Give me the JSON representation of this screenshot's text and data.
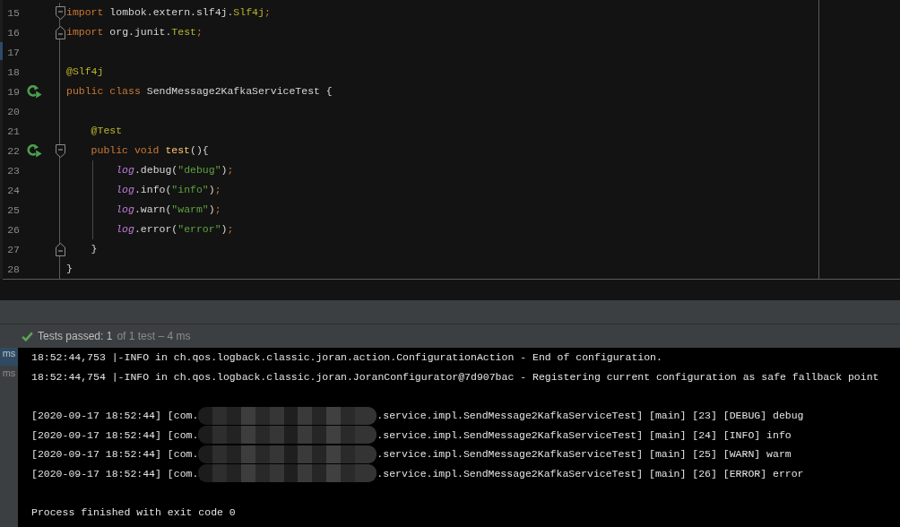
{
  "editor": {
    "lines": [
      {
        "number": "15",
        "run_icon": false,
        "fold_start": true,
        "fold_end": false,
        "tokens": [
          {
            "text": "import",
            "kind": "keyword"
          },
          {
            "text": " lombok.extern.slf4j.",
            "kind": "plain"
          },
          {
            "text": "Slf4j",
            "kind": "type"
          },
          {
            "text": ";",
            "kind": "punct"
          }
        ]
      },
      {
        "number": "16",
        "run_icon": false,
        "fold_start": false,
        "fold_end": true,
        "tokens": [
          {
            "text": "import",
            "kind": "keyword"
          },
          {
            "text": " org.junit.",
            "kind": "plain"
          },
          {
            "text": "Test",
            "kind": "type"
          },
          {
            "text": ";",
            "kind": "punct"
          }
        ]
      },
      {
        "number": "17",
        "run_icon": false,
        "fold_start": false,
        "fold_end": false
      },
      {
        "number": "18",
        "run_icon": false,
        "fold_start": false,
        "fold_end": false,
        "tokens": [
          {
            "text": "@Slf4j",
            "kind": "annotation"
          }
        ]
      },
      {
        "number": "19",
        "run_icon": true,
        "fold_start": false,
        "fold_end": false,
        "tokens": [
          {
            "text": "public class",
            "kind": "keyword"
          },
          {
            "text": " SendMessage2KafkaServiceTest {",
            "kind": "plain"
          }
        ],
        "children": [
          {
            "number": "20",
            "run_icon": false,
            "fold_start": false,
            "fold_end": false
          },
          {
            "number": "21",
            "run_icon": false,
            "fold_start": false,
            "fold_end": false,
            "tokens": [
              {
                "text": "@Test",
                "kind": "annotation"
              }
            ]
          },
          {
            "number": "22",
            "run_icon": true,
            "fold_start": true,
            "fold_end": false,
            "tokens": [
              {
                "text": "public void",
                "kind": "keyword"
              },
              {
                "text": " test",
                "kind": "method"
              },
              {
                "text": "(){",
                "kind": "plain"
              }
            ],
            "children": [
              {
                "number": "23",
                "run_icon": false,
                "fold_start": false,
                "fold_end": false,
                "tokens": [
                  {
                    "text": "log",
                    "kind": "field"
                  },
                  {
                    "text": ".debug(",
                    "kind": "plain"
                  },
                  {
                    "text": "\"debug\"",
                    "kind": "string"
                  },
                  {
                    "text": ")",
                    "kind": "plain"
                  },
                  {
                    "text": ";",
                    "kind": "punct"
                  }
                ]
              },
              {
                "number": "24",
                "run_icon": false,
                "fold_start": false,
                "fold_end": false,
                "tokens": [
                  {
                    "text": "log",
                    "kind": "field"
                  },
                  {
                    "text": ".info(",
                    "kind": "plain"
                  },
                  {
                    "text": "\"info\"",
                    "kind": "string"
                  },
                  {
                    "text": ")",
                    "kind": "plain"
                  },
                  {
                    "text": ";",
                    "kind": "punct"
                  }
                ]
              },
              {
                "number": "25",
                "run_icon": false,
                "fold_start": false,
                "fold_end": false,
                "tokens": [
                  {
                    "text": "log",
                    "kind": "field"
                  },
                  {
                    "text": ".warn(",
                    "kind": "plain"
                  },
                  {
                    "text": "\"warm\"",
                    "kind": "string"
                  },
                  {
                    "text": ")",
                    "kind": "plain"
                  },
                  {
                    "text": ";",
                    "kind": "punct"
                  }
                ]
              },
              {
                "number": "26",
                "run_icon": false,
                "fold_start": false,
                "fold_end": false,
                "tokens": [
                  {
                    "text": "log",
                    "kind": "field"
                  },
                  {
                    "text": ".error(",
                    "kind": "plain"
                  },
                  {
                    "text": "\"error\"",
                    "kind": "string"
                  },
                  {
                    "text": ")",
                    "kind": "plain"
                  },
                  {
                    "text": ";",
                    "kind": "punct"
                  }
                ]
              }
            ]
          },
          {
            "number": "27",
            "run_icon": false,
            "fold_start": false,
            "fold_end": true,
            "tokens": [
              {
                "text": "}",
                "kind": "plain"
              }
            ]
          }
        ]
      },
      {
        "number": "28",
        "run_icon": false,
        "fold_start": false,
        "fold_end": false,
        "tokens": [
          {
            "text": "}",
            "kind": "plain"
          }
        ]
      }
    ]
  },
  "test_status": {
    "passed": true,
    "summary": "Tests passed: 1",
    "detail": "of 1 test – 4 ms"
  },
  "console": {
    "gutter": [
      {
        "text": "ms",
        "selected": true
      },
      {
        "text": "ms",
        "selected": false
      }
    ],
    "lines": [
      {
        "kind": "text",
        "text": "18:52:44,753 |-INFO in ch.qos.logback.classic.joran.action.ConfigurationAction - End of configuration."
      },
      {
        "kind": "text",
        "text": "18:52:44,754 |-INFO in ch.qos.logback.classic.joran.JoranConfigurator@7d907bac - Registering current configuration as safe fallback point"
      },
      {
        "kind": "blank"
      },
      {
        "kind": "redacted",
        "prefix": "[2020-09-17 18:52:44] [com.",
        "suffix": ".service.impl.SendMessage2KafkaServiceTest] [main] [23] [DEBUG] debug"
      },
      {
        "kind": "redacted",
        "prefix": "[2020-09-17 18:52:44] [com.",
        "suffix": ".service.impl.SendMessage2KafkaServiceTest] [main] [24] [INFO] info"
      },
      {
        "kind": "redacted",
        "prefix": "[2020-09-17 18:52:44] [com.",
        "suffix": ".service.impl.SendMessage2KafkaServiceTest] [main] [25] [WARN] warm"
      },
      {
        "kind": "redacted",
        "prefix": "[2020-09-17 18:52:44] [com.",
        "suffix": ".service.impl.SendMessage2KafkaServiceTest] [main] [26] [ERROR] error"
      },
      {
        "kind": "blank"
      },
      {
        "kind": "text",
        "text": "Process finished with exit code 0"
      }
    ]
  }
}
